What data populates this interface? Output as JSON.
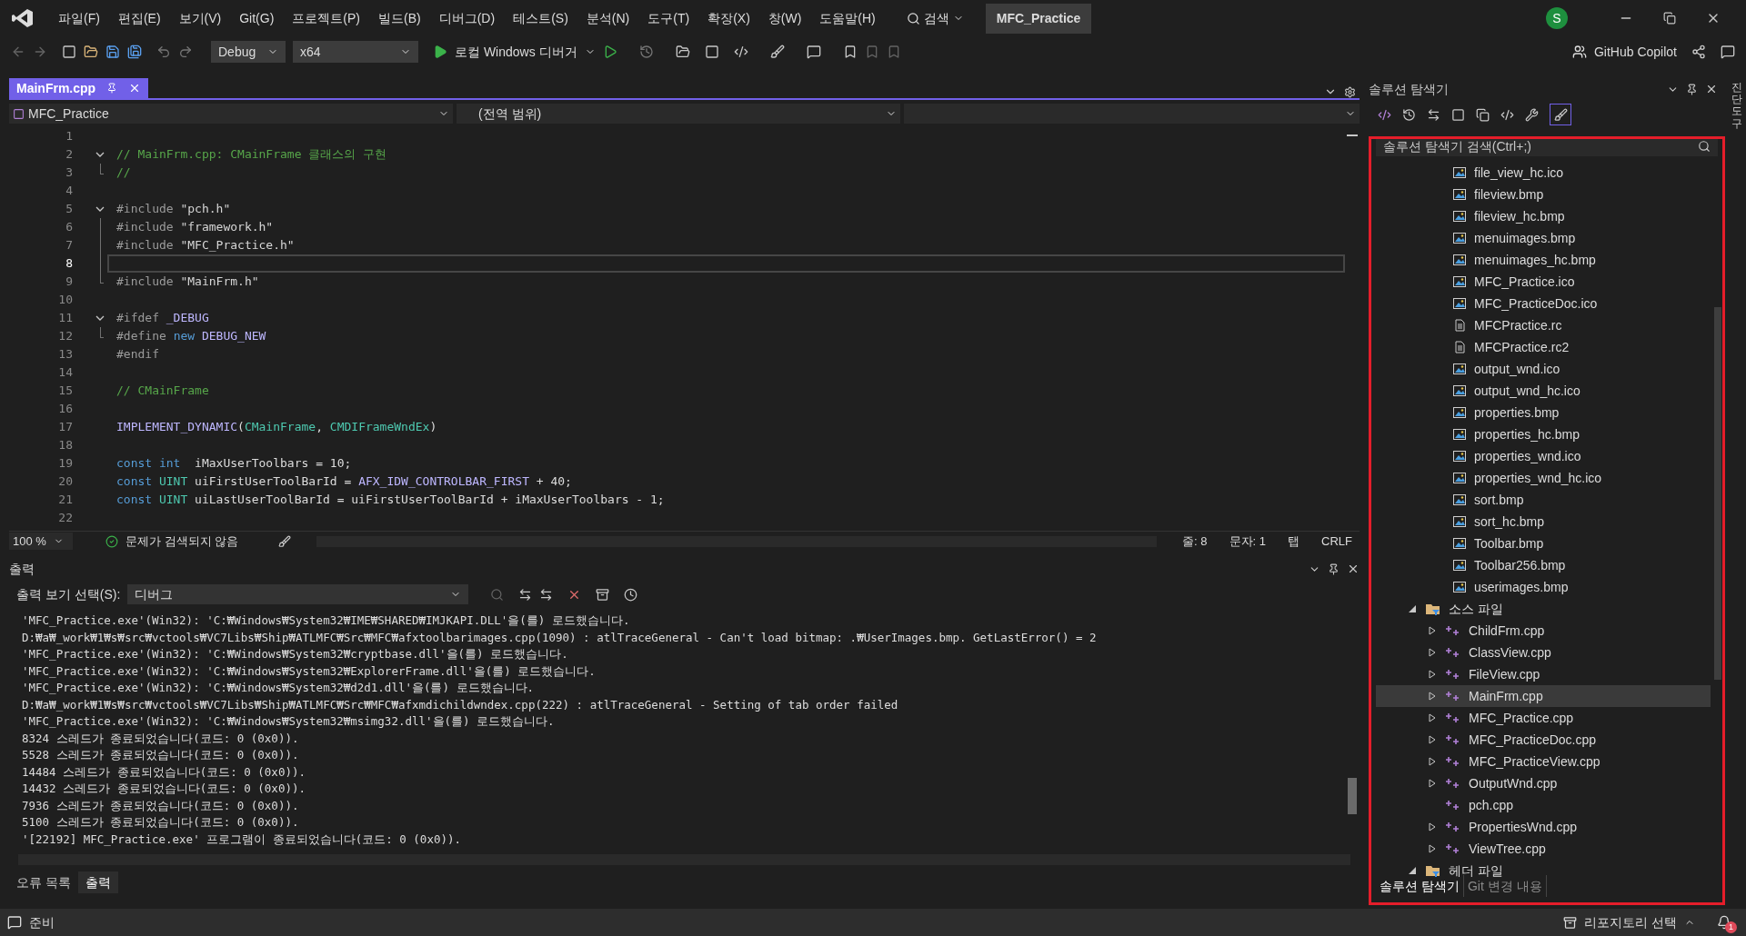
{
  "menu": [
    "파일(F)",
    "편집(E)",
    "보기(V)",
    "Git(G)",
    "프로젝트(P)",
    "빌드(B)",
    "디버그(D)",
    "테스트(S)",
    "분석(N)",
    "도구(T)",
    "확장(X)",
    "창(W)",
    "도움말(H)"
  ],
  "search": "검색",
  "solution_name": "MFC_Practice",
  "avatar": "S",
  "toolbar": {
    "configuration": "Debug",
    "platform": "x64",
    "debugger": "로컬 Windows 디버거",
    "copilot": "GitHub Copilot"
  },
  "editor": {
    "tab": "MainFrm.cpp",
    "nav": [
      "MFC_Practice",
      "(전역 범위)"
    ],
    "lines": [
      {
        "number": "1",
        "current": false
      },
      {
        "number": "2",
        "current": false,
        "folded": false,
        "tokens": [
          {
            "kind": "comment",
            "t": "// MainFrm.cpp: CMainFrame 클래스의 구현"
          }
        ]
      },
      {
        "number": "3",
        "current": false,
        "guided": true,
        "tokens": [
          {
            "kind": "comment",
            "t": "//"
          }
        ]
      },
      {
        "number": "4",
        "current": false
      },
      {
        "number": "5",
        "current": false,
        "folded": false,
        "tokens": [
          {
            "kind": "preproc",
            "t": "#include "
          },
          {
            "kind": "string",
            "t": "\"pch.h\""
          }
        ]
      },
      {
        "number": "6",
        "current": false,
        "guided": true,
        "tokens": [
          {
            "kind": "preproc",
            "t": "#include "
          },
          {
            "kind": "string",
            "t": "\"framework.h\""
          }
        ]
      },
      {
        "number": "7",
        "current": false,
        "guided": true,
        "tokens": [
          {
            "kind": "preproc",
            "t": "#include "
          },
          {
            "kind": "string",
            "t": "\"MFC_Practice.h\""
          }
        ]
      },
      {
        "number": "8",
        "current": true,
        "guided": true
      },
      {
        "number": "9",
        "current": false,
        "guided": true,
        "tokens": [
          {
            "kind": "preproc",
            "t": "#include "
          },
          {
            "kind": "string",
            "t": "\"MainFrm.h\""
          }
        ]
      },
      {
        "number": "10",
        "current": false
      },
      {
        "number": "11",
        "current": false,
        "folded": false,
        "tokens": [
          {
            "kind": "preproc",
            "t": "#ifdef "
          },
          {
            "kind": "macro",
            "t": "_DEBUG"
          }
        ]
      },
      {
        "number": "12",
        "current": false,
        "guided": true,
        "tokens": [
          {
            "kind": "preproc",
            "t": "#define "
          },
          {
            "kind": "keyword",
            "t": "new "
          },
          {
            "kind": "macro",
            "t": "DEBUG_NEW"
          }
        ]
      },
      {
        "number": "13",
        "current": false,
        "tokens": [
          {
            "kind": "preproc",
            "t": "#endif"
          }
        ]
      },
      {
        "number": "14",
        "current": false
      },
      {
        "number": "15",
        "current": false,
        "tokens": [
          {
            "kind": "comment",
            "t": "// CMainFrame"
          }
        ]
      },
      {
        "number": "16",
        "current": false
      },
      {
        "number": "17",
        "current": false,
        "tokens": [
          {
            "kind": "macro",
            "t": "IMPLEMENT_DYNAMIC"
          },
          {
            "kind": "plain",
            "t": "("
          },
          {
            "kind": "type",
            "t": "CMainFrame"
          },
          {
            "kind": "plain",
            "t": ", "
          },
          {
            "kind": "type",
            "t": "CMDIFrameWndEx"
          },
          {
            "kind": "plain",
            "t": ")"
          }
        ]
      },
      {
        "number": "18",
        "current": false
      },
      {
        "number": "19",
        "current": false,
        "tokens": [
          {
            "kind": "keyword",
            "t": "const int"
          },
          {
            "kind": "plain",
            "t": "  iMaxUserToolbars = 10;"
          }
        ]
      },
      {
        "number": "20",
        "current": false,
        "tokens": [
          {
            "kind": "keyword",
            "t": "const "
          },
          {
            "kind": "type",
            "t": "UINT"
          },
          {
            "kind": "plain",
            "t": " uiFirstUserToolBarId = "
          },
          {
            "kind": "macro",
            "t": "AFX_IDW_CONTROLBAR_FIRST"
          },
          {
            "kind": "plain",
            "t": " + 40;"
          }
        ]
      },
      {
        "number": "21",
        "current": false,
        "tokens": [
          {
            "kind": "keyword",
            "t": "const "
          },
          {
            "kind": "type",
            "t": "UINT"
          },
          {
            "kind": "plain",
            "t": " uiLastUserToolBarId = uiFirstUserToolBarId + iMaxUserToolbars - 1;"
          }
        ]
      },
      {
        "number": "22",
        "current": false
      }
    ],
    "zoom": "100 %",
    "issues": "문제가 검색되지 않음",
    "line_info": "줄: 8",
    "col_info": "문자: 1",
    "indent": "탭",
    "eol": "CRLF"
  },
  "output": {
    "title": "출력",
    "source_label": "출력 보기 선택(S):",
    "source": "디버그",
    "lines": [
      "'MFC_Practice.exe'(Win32): 'C:₩Windows₩System32₩IME₩SHARED₩IMJKAPI.DLL'을(를) 로드했습니다.",
      "D:₩a₩_work₩1₩s₩src₩vctools₩VC7Libs₩Ship₩ATLMFC₩Src₩MFC₩afxtoolbarimages.cpp(1090) : atlTraceGeneral - Can't load bitmap: .₩UserImages.bmp. GetLastError() = 2",
      "'MFC_Practice.exe'(Win32): 'C:₩Windows₩System32₩cryptbase.dll'을(를) 로드했습니다.",
      "'MFC_Practice.exe'(Win32): 'C:₩Windows₩System32₩ExplorerFrame.dll'을(를) 로드했습니다.",
      "'MFC_Practice.exe'(Win32): 'C:₩Windows₩System32₩d2d1.dll'을(를) 로드했습니다.",
      "D:₩a₩_work₩1₩s₩src₩vctools₩VC7Libs₩Ship₩ATLMFC₩Src₩MFC₩afxmdichildwndex.cpp(222) : atlTraceGeneral - Setting of tab order failed",
      "'MFC_Practice.exe'(Win32): 'C:₩Windows₩System32₩msimg32.dll'을(를) 로드했습니다.",
      "8324 스레드가 종료되었습니다(코드: 0 (0x0)).",
      "5528 스레드가 종료되었습니다(코드: 0 (0x0)).",
      "14484 스레드가 종료되었습니다(코드: 0 (0x0)).",
      "14432 스레드가 종료되었습니다(코드: 0 (0x0)).",
      "7936 스레드가 종료되었습니다(코드: 0 (0x0)).",
      "5100 스레드가 종료되었습니다(코드: 0 (0x0)).",
      "'[22192] MFC_Practice.exe' 프로그램이 종료되었습니다(코드: 0 (0x0))."
    ]
  },
  "bottom_tabs": [
    {
      "label": "오류 목록",
      "selected": false
    },
    {
      "label": "출력",
      "selected": true
    }
  ],
  "solution_explorer": {
    "title": "솔루션 탐색기",
    "search_placeholder": "솔루션 탐색기 검색(Ctrl+;)",
    "files": [
      {
        "label": "file_view_hc.ico",
        "kind": "image"
      },
      {
        "label": "fileview.bmp",
        "kind": "image"
      },
      {
        "label": "fileview_hc.bmp",
        "kind": "image"
      },
      {
        "label": "menuimages.bmp",
        "kind": "image"
      },
      {
        "label": "menuimages_hc.bmp",
        "kind": "image"
      },
      {
        "label": "MFC_Practice.ico",
        "kind": "image"
      },
      {
        "label": "MFC_PracticeDoc.ico",
        "kind": "image"
      },
      {
        "label": "MFCPractice.rc",
        "kind": "resource"
      },
      {
        "label": "MFCPractice.rc2",
        "kind": "resource"
      },
      {
        "label": "output_wnd.ico",
        "kind": "image"
      },
      {
        "label": "output_wnd_hc.ico",
        "kind": "image"
      },
      {
        "label": "properties.bmp",
        "kind": "image"
      },
      {
        "label": "properties_hc.bmp",
        "kind": "image"
      },
      {
        "label": "properties_wnd.ico",
        "kind": "image"
      },
      {
        "label": "properties_wnd_hc.ico",
        "kind": "image"
      },
      {
        "label": "sort.bmp",
        "kind": "image"
      },
      {
        "label": "sort_hc.bmp",
        "kind": "image"
      },
      {
        "label": "Toolbar.bmp",
        "kind": "image"
      },
      {
        "label": "Toolbar256.bmp",
        "kind": "image"
      },
      {
        "label": "userimages.bmp",
        "kind": "image"
      }
    ],
    "folders": [
      {
        "label": "소스 파일",
        "expanded": true,
        "children": [
          {
            "label": "ChildFrm.cpp",
            "expandable": true,
            "selected": false
          },
          {
            "label": "ClassView.cpp",
            "expandable": true,
            "selected": false
          },
          {
            "label": "FileView.cpp",
            "expandable": true,
            "selected": false
          },
          {
            "label": "MainFrm.cpp",
            "expandable": true,
            "selected": true
          },
          {
            "label": "MFC_Practice.cpp",
            "expandable": true,
            "selected": false
          },
          {
            "label": "MFC_PracticeDoc.cpp",
            "expandable": true,
            "selected": false
          },
          {
            "label": "MFC_PracticeView.cpp",
            "expandable": true,
            "selected": false
          },
          {
            "label": "OutputWnd.cpp",
            "expandable": true,
            "selected": false
          },
          {
            "label": "pch.cpp",
            "expandable": false,
            "selected": false
          },
          {
            "label": "PropertiesWnd.cpp",
            "expandable": true,
            "selected": false
          },
          {
            "label": "ViewTree.cpp",
            "expandable": true,
            "selected": false
          }
        ]
      },
      {
        "label": "헤더 파일",
        "expanded": true
      }
    ],
    "tabs": [
      {
        "label": "솔루션 탐색기",
        "selected": true
      },
      {
        "label": "Git 변경 내용",
        "selected": false
      }
    ]
  },
  "side_strip": "진단 도구",
  "status": {
    "text": "준비",
    "repo": "리포지토리 선택",
    "notifications": "1"
  }
}
